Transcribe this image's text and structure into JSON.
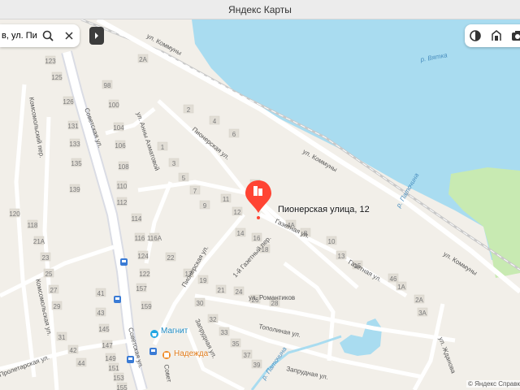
{
  "window": {
    "title": "Яндекс Карты"
  },
  "search": {
    "query": "в, ул. Пио"
  },
  "pin": {
    "label": "Пионерская улица, 12"
  },
  "poi": {
    "magnit": "Магнит",
    "nadezhda": "Надежда",
    "bus_icon": "bus-stop-icon"
  },
  "water": {
    "label": "р. Вятка"
  },
  "streets": {
    "kommuny_top": "ул. Коммуны",
    "kommuny_mid": "ул. Коммуны",
    "kommuny_low": "ул. Коммуны",
    "sovetskaya": "Советская ул.",
    "sovetskaya_low": "Советская ул.",
    "sovetskaya_bottom": "Совет",
    "pionerskaya_upper": "Пионерская ул.",
    "pionerskaya_lower": "Пионерская ул.",
    "akhmatovoy": "ул. Анны Ахматовой",
    "gazetnaya": "Газетная ул.",
    "gazetnaya_east": "Газетная ул.",
    "gazetny_per": "1-й Газетный пер.",
    "romantikov": "ул. Романтиков",
    "topolinaya": "Тополиная ул.",
    "zaprudnaya": "Запрудная ул.",
    "zaprudnaya_low": "Запрудная ул.",
    "zhdanova": "ул. Жданова",
    "komsomolsky_per": "Комсомольский пер.",
    "komsomolskaya": "Комсомольская ул.",
    "proletarskaya": "Пролетарская ул.",
    "patochina": "р. Паточина",
    "patochina_low": "р. Паточина"
  },
  "house_numbers": [
    {
      "t": "116"
    },
    {
      "t": "123"
    },
    {
      "t": "125"
    },
    {
      "t": "126"
    },
    {
      "t": "131"
    },
    {
      "t": "133"
    },
    {
      "t": "135"
    },
    {
      "t": "139"
    },
    {
      "t": "2А"
    },
    {
      "t": "98"
    },
    {
      "t": "100"
    },
    {
      "t": "104"
    },
    {
      "t": "106"
    },
    {
      "t": "108"
    },
    {
      "t": "110"
    },
    {
      "t": "112"
    },
    {
      "t": "114"
    },
    {
      "t": "116"
    },
    {
      "t": "116А"
    },
    {
      "t": "2"
    },
    {
      "t": "4"
    },
    {
      "t": "6"
    },
    {
      "t": "1"
    },
    {
      "t": "3"
    },
    {
      "t": "5"
    },
    {
      "t": "7"
    },
    {
      "t": "9"
    },
    {
      "t": "11"
    },
    {
      "t": "12"
    },
    {
      "t": "14"
    },
    {
      "t": "16"
    },
    {
      "t": "18"
    },
    {
      "t": "20"
    },
    {
      "t": "22"
    },
    {
      "t": "17"
    },
    {
      "t": "19"
    },
    {
      "t": "21"
    },
    {
      "t": "24"
    },
    {
      "t": "26"
    },
    {
      "t": "28"
    },
    {
      "t": "30"
    },
    {
      "t": "32"
    },
    {
      "t": "33"
    },
    {
      "t": "35"
    },
    {
      "t": "37"
    },
    {
      "t": "39"
    },
    {
      "t": "41"
    },
    {
      "t": "43"
    },
    {
      "t": "145"
    },
    {
      "t": "147"
    },
    {
      "t": "149"
    },
    {
      "t": "151"
    },
    {
      "t": "153"
    },
    {
      "t": "155"
    },
    {
      "t": "157"
    },
    {
      "t": "159"
    },
    {
      "t": "122"
    },
    {
      "t": "124"
    },
    {
      "t": "120"
    },
    {
      "t": "118"
    },
    {
      "t": "21А"
    },
    {
      "t": "23"
    },
    {
      "t": "25"
    },
    {
      "t": "27"
    },
    {
      "t": "29"
    },
    {
      "t": "31"
    },
    {
      "t": "42"
    },
    {
      "t": "44"
    },
    {
      "t": "46"
    },
    {
      "t": "1А"
    },
    {
      "t": "2А"
    },
    {
      "t": "3А"
    },
    {
      "t": "4А"
    },
    {
      "t": "8"
    },
    {
      "t": "10"
    },
    {
      "t": "13"
    },
    {
      "t": "15"
    }
  ],
  "tools": {
    "layers": "layers-icon",
    "route": "route-icon",
    "panorama": "camera-icon"
  },
  "attribution": "© Яндекс  Справка"
}
